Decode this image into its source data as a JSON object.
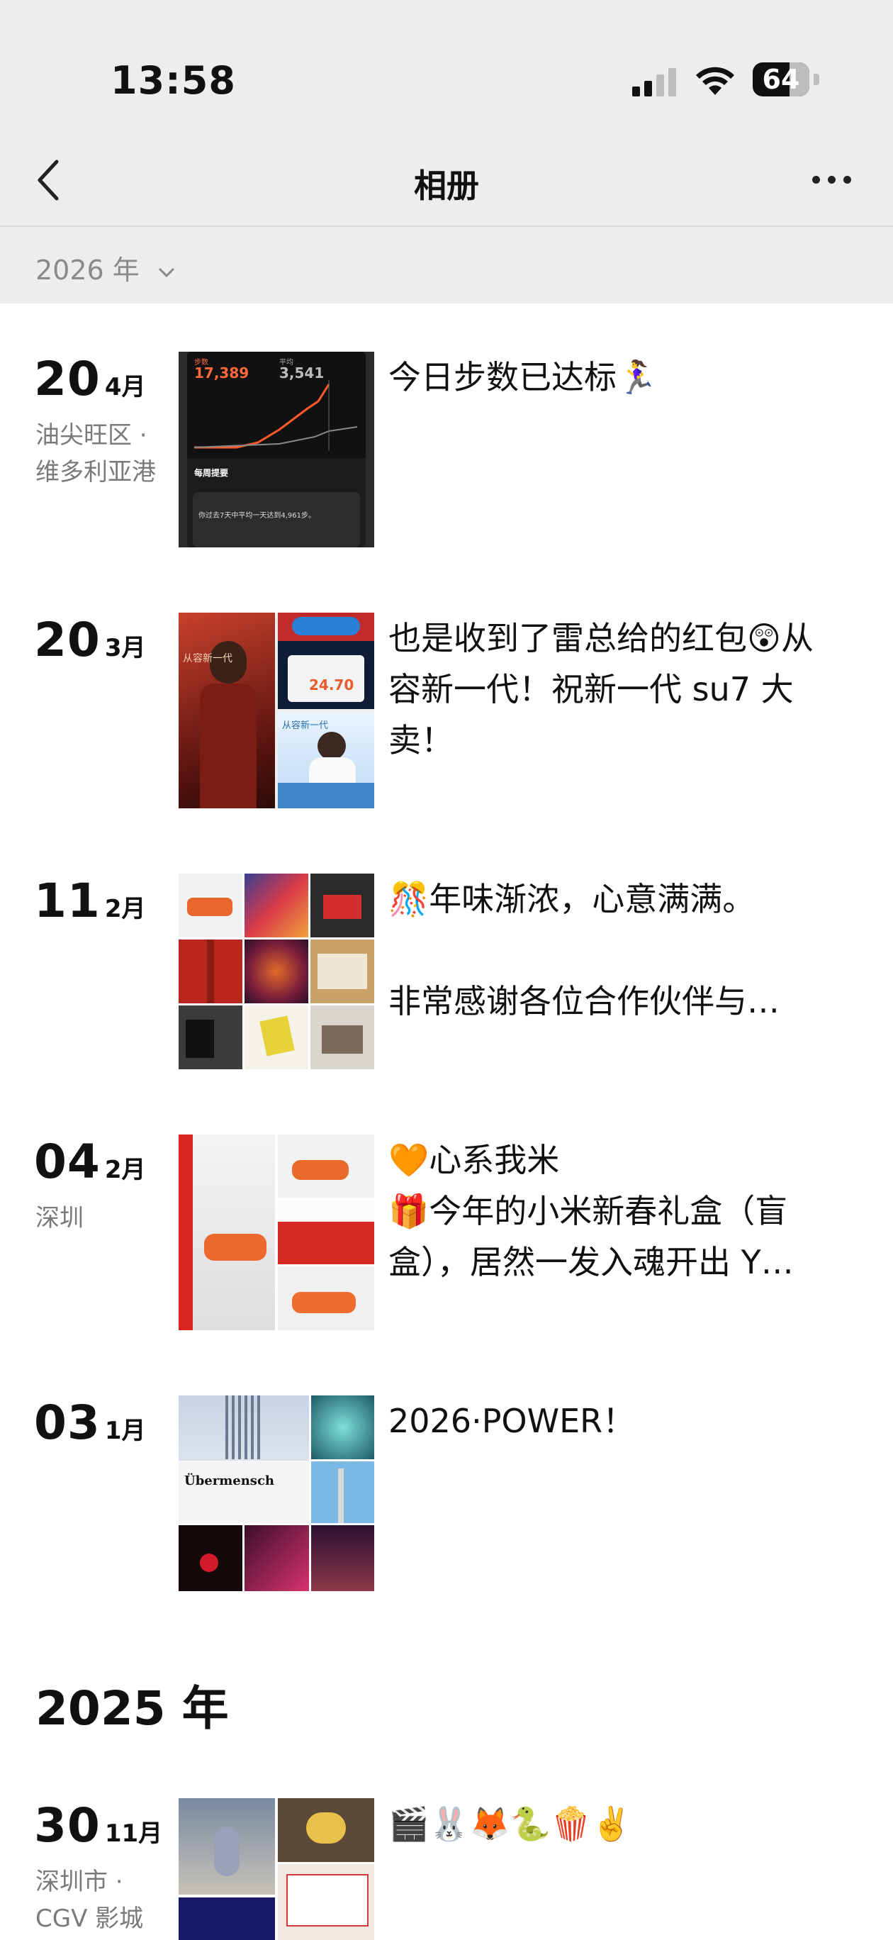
{
  "status_bar": {
    "time": "13:58",
    "battery": "64"
  },
  "nav": {
    "title": "相册"
  },
  "year_filter": "2026 年",
  "entries": [
    {
      "day": "20",
      "month": "4月",
      "location": "油尖旺区 · 维多利亚港",
      "text": "今日步数已达标🏃‍♀️",
      "thumb": {
        "steps": "17,389",
        "avg": "3,541",
        "label_a": "步数",
        "label_b": "平均",
        "summary": "每周提要",
        "line": "你过去7天中平均一天达到4,961步。"
      }
    },
    {
      "day": "20",
      "month": "3月",
      "location": "",
      "text": "也是收到了雷总给的红包😲从容新一代！祝新一代 su7 大卖！",
      "thumb": {
        "a": "从容新一代",
        "b": "24.70",
        "c": "从容新一代"
      }
    },
    {
      "day": "11",
      "month": "2月",
      "location": "",
      "text": "🎊年味渐浓，心意满满。\n\n非常感谢各位合作伙伴与…"
    },
    {
      "day": "04",
      "month": "2月",
      "location": "深圳",
      "text": "🧡心系我米\n🎁今年的小米新春礼盒（盲盒），居然一发入魂开出 Y…"
    },
    {
      "day": "03",
      "month": "1月",
      "location": "",
      "text": "2026·POWER！",
      "thumb": {
        "sign": "Übermensch"
      }
    },
    {
      "day": "30",
      "month": "11月",
      "location": "深圳市 · CGV 影城",
      "text": "🎬🐰🦊🐍🍿✌️"
    }
  ],
  "year_heading": "2025 年"
}
